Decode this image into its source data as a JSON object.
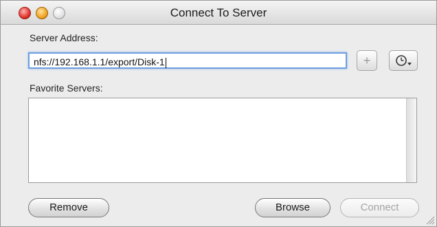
{
  "window": {
    "title": "Connect To Server"
  },
  "server_address": {
    "label": "Server Address:",
    "value": "nfs://192.168.1.1/export/Disk-1"
  },
  "add_button": {
    "glyph": "+"
  },
  "recent_button": {
    "icon": "clock-icon",
    "arrow": "▾"
  },
  "favorites": {
    "label": "Favorite Servers:",
    "items": []
  },
  "buttons": {
    "remove": "Remove",
    "browse": "Browse",
    "connect": "Connect"
  }
}
